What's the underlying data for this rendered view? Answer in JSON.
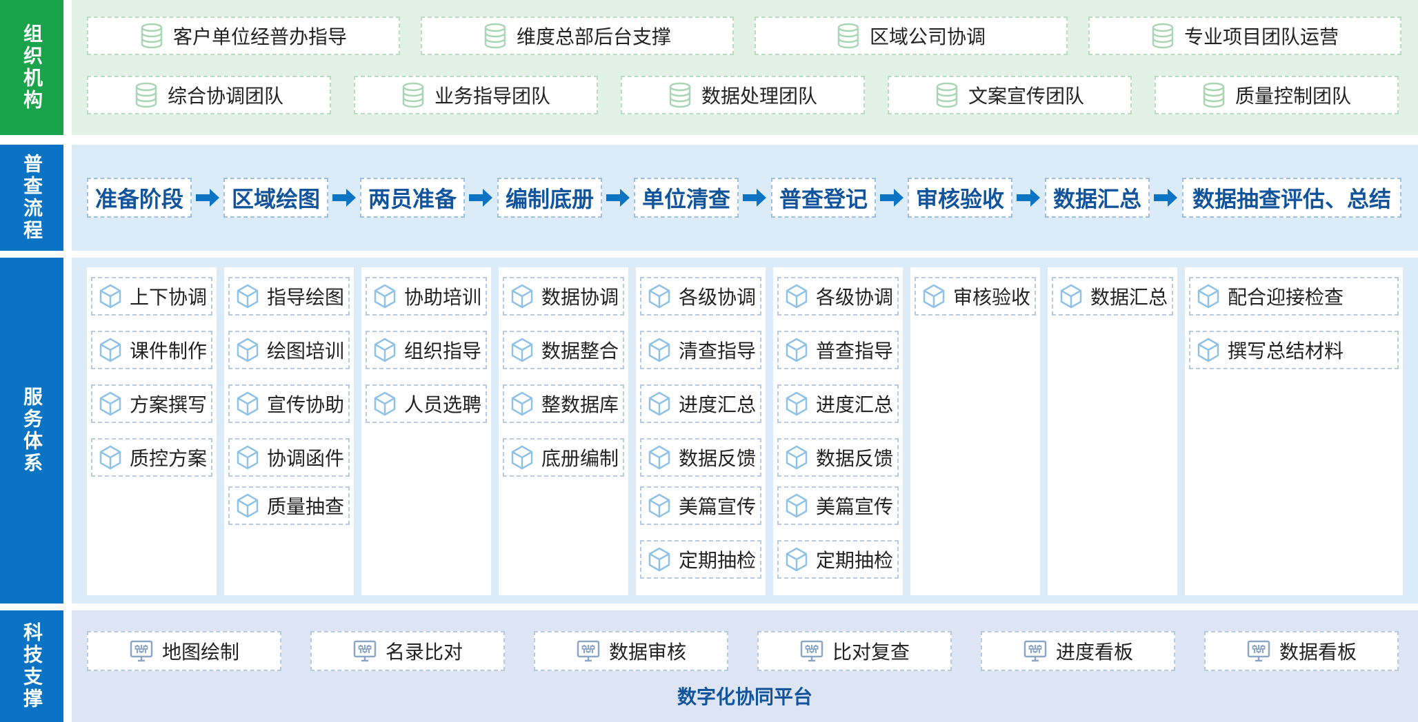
{
  "colors": {
    "green_accent": "#1aa34a",
    "blue_accent": "#0a73c4",
    "process_text": "#12549c",
    "green_panel": "#e3f2e6",
    "blue_panel": "#dbecf8"
  },
  "rows": {
    "org": {
      "label": "组织机构",
      "icon": "database-icon",
      "top_items": [
        "客户单位经普办指导",
        "维度总部后台支撑",
        "区域公司协调",
        "专业项目团队运营"
      ],
      "bottom_items": [
        "综合协调团队",
        "业务指导团队",
        "数据处理团队",
        "文案宣传团队",
        "质量控制团队"
      ]
    },
    "process": {
      "label": "普查流程",
      "icon": "arrow-right-icon",
      "steps": [
        "准备阶段",
        "区域绘图",
        "两员准备",
        "编制底册",
        "单位清查",
        "普查登记",
        "审核验收",
        "数据汇总",
        "数据抽查评估、总结"
      ]
    },
    "service": {
      "label": "服务体系",
      "icon": "cube-icon",
      "columns": [
        [
          "上下协调",
          "课件制作",
          "方案撰写",
          "质控方案"
        ],
        [
          "指导绘图",
          "绘图培训",
          "宣传协助",
          "协调函件",
          "质量抽查"
        ],
        [
          "协助培训",
          "组织指导",
          "人员选聘"
        ],
        [
          "数据协调",
          "数据整合",
          "整数据库",
          "底册编制"
        ],
        [
          "各级协调",
          "清查指导",
          "进度汇总",
          "数据反馈",
          "美篇宣传",
          "定期抽检"
        ],
        [
          "各级协调",
          "普查指导",
          "进度汇总",
          "数据反馈",
          "美篇宣传",
          "定期抽检"
        ],
        [
          "审核验收"
        ],
        [
          "数据汇总"
        ],
        [
          "配合迎接检查",
          "撰写总结材料"
        ]
      ]
    },
    "tech": {
      "label": "科技支撑",
      "icon": "monitor-settings-icon",
      "items": [
        "地图绘制",
        "名录比对",
        "数据审核",
        "比对复查",
        "进度看板",
        "数据看板"
      ],
      "platform": "数字化协同平台"
    }
  }
}
